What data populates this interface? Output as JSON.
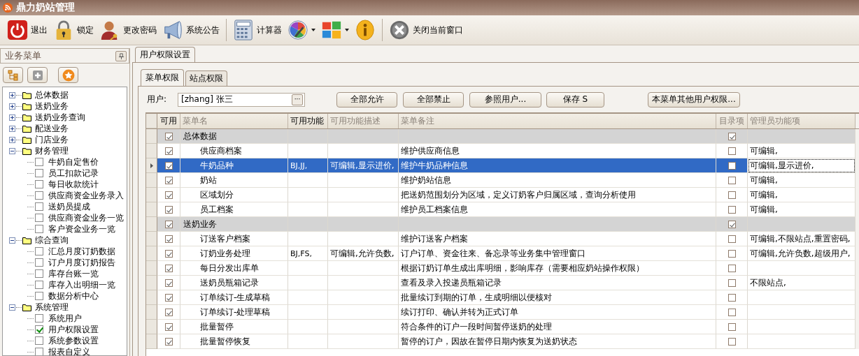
{
  "window": {
    "title": "鼎力奶站管理"
  },
  "toolbar": [
    {
      "kind": "power",
      "label": "退出"
    },
    {
      "kind": "lock",
      "label": "锁定"
    },
    {
      "kind": "user",
      "label": "更改密码"
    },
    {
      "kind": "megaphone",
      "label": "系统公告"
    },
    {
      "kind": "separator"
    },
    {
      "kind": "calculator",
      "label": "计算器"
    },
    {
      "kind": "palette",
      "dropdown": true
    },
    {
      "kind": "windows",
      "dropdown": true
    },
    {
      "kind": "info"
    },
    {
      "kind": "separator"
    },
    {
      "kind": "close",
      "label": "关闭当前窗口"
    }
  ],
  "sidebar": {
    "title": "业务菜单",
    "tree": [
      {
        "label": "总体数据",
        "expanded": false
      },
      {
        "label": "送奶业务",
        "expanded": false
      },
      {
        "label": "送奶业务查询",
        "expanded": false
      },
      {
        "label": "配送业务",
        "expanded": false
      },
      {
        "label": "门店业务",
        "expanded": false
      },
      {
        "label": "财务管理",
        "expanded": true,
        "children": [
          {
            "label": "牛奶自定售价",
            "checked": false
          },
          {
            "label": "员工扣款记录",
            "checked": false
          },
          {
            "label": "每日收款统计",
            "checked": false
          },
          {
            "label": "供应商资金业务录入",
            "checked": false
          },
          {
            "label": "送奶员提成",
            "checked": false
          },
          {
            "label": "供应商资金业务一览",
            "checked": false
          },
          {
            "label": "客户资金业务一览",
            "checked": false
          }
        ]
      },
      {
        "label": "综合查询",
        "expanded": true,
        "children": [
          {
            "label": "汇总月度订奶数据",
            "checked": false
          },
          {
            "label": "订户月度订奶报告",
            "checked": false
          },
          {
            "label": "库存台账一览",
            "checked": false
          },
          {
            "label": "库存入出明细一览",
            "checked": false
          },
          {
            "label": "数据分析中心",
            "checked": false
          }
        ]
      },
      {
        "label": "系统管理",
        "expanded": true,
        "children": [
          {
            "label": "系统用户",
            "checked": false
          },
          {
            "label": "用户权限设置",
            "checked": true
          },
          {
            "label": "系统参数设置",
            "checked": false
          },
          {
            "label": "报表自定义",
            "checked": false
          }
        ]
      }
    ]
  },
  "document_tab": {
    "label": "用户权限设置"
  },
  "tabs": [
    {
      "label": "菜单权限",
      "selected": true
    },
    {
      "label": "站点权限",
      "selected": false
    }
  ],
  "user_field": {
    "label": "用户:",
    "value": "[zhang] 张三",
    "button": "···"
  },
  "buttons": [
    "全部允许",
    "全部禁止",
    "参照用户...",
    "保存 S",
    "本菜单其他用户权限..."
  ],
  "table": {
    "columns": [
      "可用",
      "菜单名",
      "可用功能",
      "可用功能描述",
      "菜单备注",
      "目录项",
      "管理员功能项"
    ],
    "rows": [
      {
        "kind": "group",
        "enabled": true,
        "name": "总体数据",
        "functions": "",
        "description": "",
        "note": "",
        "directory": true,
        "admin": "",
        "selected": false
      },
      {
        "kind": "item",
        "enabled": true,
        "name": "供应商档案",
        "functions": "",
        "description": "",
        "note": "维护供应商信息",
        "directory": false,
        "admin": "可编辑,",
        "selected": false
      },
      {
        "kind": "item",
        "enabled": true,
        "name": "牛奶品种",
        "functions": "BJ,JJ,",
        "description": "可编辑,显示进价,",
        "note": "维护牛奶品种信息",
        "directory": false,
        "admin": "可编辑,显示进价,",
        "selected": true
      },
      {
        "kind": "item",
        "enabled": true,
        "name": "奶站",
        "functions": "",
        "description": "",
        "note": "维护奶站信息",
        "directory": false,
        "admin": "可编辑,",
        "selected": false
      },
      {
        "kind": "item",
        "enabled": true,
        "name": "区域划分",
        "functions": "",
        "description": "",
        "note": "把送奶范围划分为区域，定义订奶客户归属区域，查询分析使用",
        "directory": false,
        "admin": "可编辑,",
        "selected": false
      },
      {
        "kind": "item",
        "enabled": true,
        "name": "员工档案",
        "functions": "",
        "description": "",
        "note": "维护员工档案信息",
        "directory": false,
        "admin": "可编辑,",
        "selected": false
      },
      {
        "kind": "group",
        "enabled": true,
        "name": "送奶业务",
        "functions": "",
        "description": "",
        "note": "",
        "directory": true,
        "admin": "",
        "selected": false
      },
      {
        "kind": "item",
        "enabled": true,
        "name": "订送客户档案",
        "functions": "",
        "description": "",
        "note": "维护订送客户档案",
        "directory": false,
        "admin": "可编辑,不限站点,重置密码,",
        "selected": false
      },
      {
        "kind": "item",
        "enabled": true,
        "name": "订奶业务处理",
        "functions": "BJ,FS,",
        "description": "可编辑,允许负数,",
        "note": "订户订单、资金往来、备忘录等业务集中管理窗口",
        "directory": false,
        "admin": "可编辑,允许负数,超级用户,",
        "selected": false
      },
      {
        "kind": "item",
        "enabled": true,
        "name": "每日分发出库单",
        "functions": "",
        "description": "",
        "note": "根据订奶订单生成出库明细，影响库存（需要相应奶站操作权限）",
        "directory": false,
        "admin": "",
        "selected": false
      },
      {
        "kind": "item",
        "enabled": true,
        "name": "送奶员瓶箱记录",
        "functions": "",
        "description": "",
        "note": "查看及录入投递员瓶箱记录",
        "directory": false,
        "admin": "不限站点,",
        "selected": false
      },
      {
        "kind": "item",
        "enabled": true,
        "name": "订单续订-生成草稿",
        "functions": "",
        "description": "",
        "note": "批量续订到期的订单，生成明细以便核对",
        "directory": false,
        "admin": "",
        "selected": false
      },
      {
        "kind": "item",
        "enabled": true,
        "name": "订单续订-处理草稿",
        "functions": "",
        "description": "",
        "note": "续订打印、确认并转为正式订单",
        "directory": false,
        "admin": "",
        "selected": false
      },
      {
        "kind": "item",
        "enabled": true,
        "name": "批量暂停",
        "functions": "",
        "description": "",
        "note": "符合条件的订户一段时间暂停送奶的处理",
        "directory": false,
        "admin": "",
        "selected": false
      },
      {
        "kind": "item",
        "enabled": true,
        "name": "批量暂停恢复",
        "functions": "",
        "description": "",
        "note": "暂停的订户，因故在暂停日期内恢复为送奶状态",
        "directory": false,
        "admin": "",
        "selected": false
      }
    ]
  }
}
